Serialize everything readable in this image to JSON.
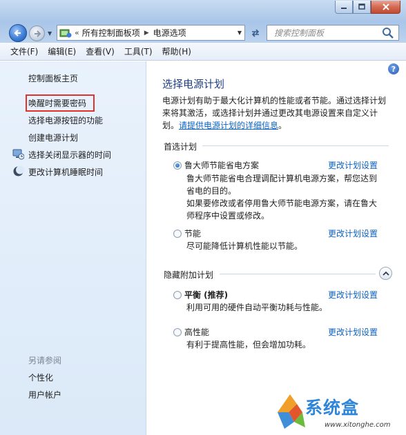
{
  "window": {
    "controls": [
      "minimize-icon",
      "maximize-icon",
      "close-icon"
    ]
  },
  "address_bar": {
    "separator": "«",
    "breadcrumbs": [
      "所有控制面板项",
      "电源选项"
    ],
    "search_placeholder": "搜索控制面板"
  },
  "menu": {
    "items": [
      "文件(F)",
      "编辑(E)",
      "查看(V)",
      "工具(T)",
      "帮助(H)"
    ]
  },
  "sidebar": {
    "home": "控制面板主页",
    "links": [
      {
        "label": "唤醒时需要密码",
        "highlighted": true
      },
      {
        "label": "选择电源按钮的功能"
      },
      {
        "label": "创建电源计划"
      },
      {
        "label": "选择关闭显示器的时间",
        "icon": "monitor-icon"
      },
      {
        "label": "更改计算机睡眠时间",
        "icon": "moon-icon"
      }
    ],
    "see_also": "另请参阅",
    "see_also_links": [
      "个性化",
      "用户帐户"
    ]
  },
  "main": {
    "title": "选择电源计划",
    "desc_lines": [
      "电源计划有助于最大化计算机的性能或者节能。通过选择计划",
      "来将其激活，或选择计划并通过更改其电源设置来自定义计",
      "划。"
    ],
    "desc_link": "请提供电源计划的详细信息",
    "desc_end": "。",
    "preferred_label": "首选计划",
    "hidden_label": "隐藏附加计划",
    "change_link": "更改计划设置",
    "plans": [
      {
        "name": "鲁大师节能省电方案",
        "selected": true,
        "desc_lines": [
          "鲁大师节能省电合理调配计算机电源方案，帮您达到",
          "省电的目的。",
          "如果要修改或者停用鲁大师节能电源方案，请在鲁大",
          "师程序中设置或修改。"
        ]
      },
      {
        "name": "节能",
        "selected": false,
        "desc_lines": [
          "尽可能降低计算机性能以节能。"
        ]
      },
      {
        "name": "平衡 (推荐)",
        "selected": false,
        "desc_lines": [
          "利用可用的硬件自动平衡功耗与性能。"
        ]
      },
      {
        "name": "高性能",
        "selected": false,
        "desc_lines": [
          "有利于提高性能，但会增加功耗。"
        ]
      }
    ]
  },
  "watermark": {
    "brand": "系统盒",
    "url": "www.xitonghe.com"
  },
  "colors": {
    "link": "#0b62c4",
    "title": "#1d3e82",
    "highlight_box": "#e0332b"
  }
}
